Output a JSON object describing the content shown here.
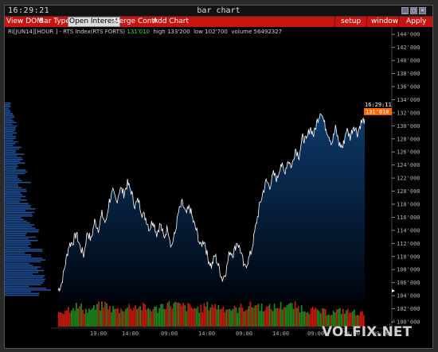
{
  "titlebar": {
    "clock": "16:29:21",
    "title": "bar chart",
    "buttons": [
      "minimize-icon",
      "maximize-icon",
      "close-icon"
    ]
  },
  "menu": {
    "items": [
      "View DOM",
      "Bar Type",
      "Open Interest",
      "Merge Contr",
      "Add Chart"
    ],
    "active_index": 2,
    "right_items": [
      "setup",
      "window",
      "Apply"
    ]
  },
  "info": {
    "symbol": "RI[JUN14]",
    "interval": "[HOUR ]",
    "name": "- RTS Index(RTS FORTS)",
    "last": "131'010",
    "high": "high 133'200",
    "low": "low 102'700",
    "volume": "volume 56492327"
  },
  "price_axis": {
    "labels": [
      "144'000",
      "142'000",
      "140'000",
      "138'000",
      "136'000",
      "134'000",
      "132'000",
      "130'000",
      "128'000",
      "126'000",
      "124'000",
      "122'000",
      "120'000",
      "118'000",
      "116'000",
      "114'000",
      "112'000",
      "110'000",
      "108'000",
      "106'000",
      "104'000",
      "102'000",
      "100'000"
    ],
    "current_time": "16:29:11",
    "current_price": "131'010"
  },
  "time_axis": {
    "labels": [
      "19:00",
      "14:00",
      "09:00",
      "14:00",
      "09:00",
      "14:00",
      "09:00",
      "14:00",
      "09:00",
      "14:00"
    ]
  },
  "colors": {
    "menu": "#c8140f",
    "price_line": "#ffffff",
    "fill_top": "#0d3a6c",
    "profile": "#1f4f98",
    "vol_up": "#1e8a1e",
    "vol_down": "#cc1a10",
    "axis_text": "#b0b0b0",
    "last_bg": "#ff6600"
  },
  "watermark": "VOLFIX.NET",
  "chart_data": {
    "type": "line",
    "ylim": [
      100000,
      145000
    ],
    "closes": [
      104800,
      106000,
      109000,
      111800,
      112200,
      113500,
      111500,
      110200,
      113800,
      112500,
      115400,
      114200,
      116500,
      115000,
      118500,
      119800,
      118400,
      120500,
      119600,
      121200,
      120000,
      117800,
      118600,
      116600,
      115900,
      114200,
      115600,
      113500,
      115000,
      112800,
      114600,
      111500,
      113500,
      116800,
      118200,
      116400,
      117600,
      115400,
      113800,
      111500,
      112600,
      109800,
      108500,
      110200,
      108400,
      106500,
      107800,
      110800,
      110400,
      112300,
      110900,
      108200,
      109300,
      110900,
      114200,
      117200,
      119600,
      121500,
      120800,
      122600,
      121800,
      124300,
      122800,
      124800,
      123700,
      126500,
      125400,
      128300,
      127600,
      129800,
      128600,
      130800,
      132400,
      130200,
      128800,
      127400,
      129600,
      127200,
      126700,
      129500,
      128300,
      130100,
      128900,
      130500,
      131000
    ],
    "volume_profile_x": [
      12,
      16,
      20,
      24,
      26,
      28,
      30,
      32,
      34,
      38,
      42,
      44,
      46,
      48,
      50,
      52,
      54,
      56,
      58,
      60,
      62,
      64,
      66,
      68,
      70,
      72,
      74,
      76,
      78,
      80,
      82,
      84,
      86,
      88,
      90
    ],
    "volume": [
      0.6,
      0.7,
      0.8,
      0.75,
      0.65,
      0.7,
      0.8,
      0.85,
      0.7,
      0.65,
      0.72,
      0.78,
      0.8,
      0.75,
      0.7,
      0.68,
      0.82,
      0.9,
      0.86,
      0.8,
      0.76,
      0.72,
      0.7,
      0.8,
      0.84,
      0.78,
      0.75,
      0.7,
      0.68,
      0.74,
      0.8,
      0.84,
      0.78,
      0.72,
      0.76,
      0.82,
      0.86,
      0.8,
      0.74,
      0.7,
      0.65,
      0.6,
      0.58,
      0.55,
      0.6,
      0.62,
      0.58,
      0.55,
      0.5
    ]
  }
}
